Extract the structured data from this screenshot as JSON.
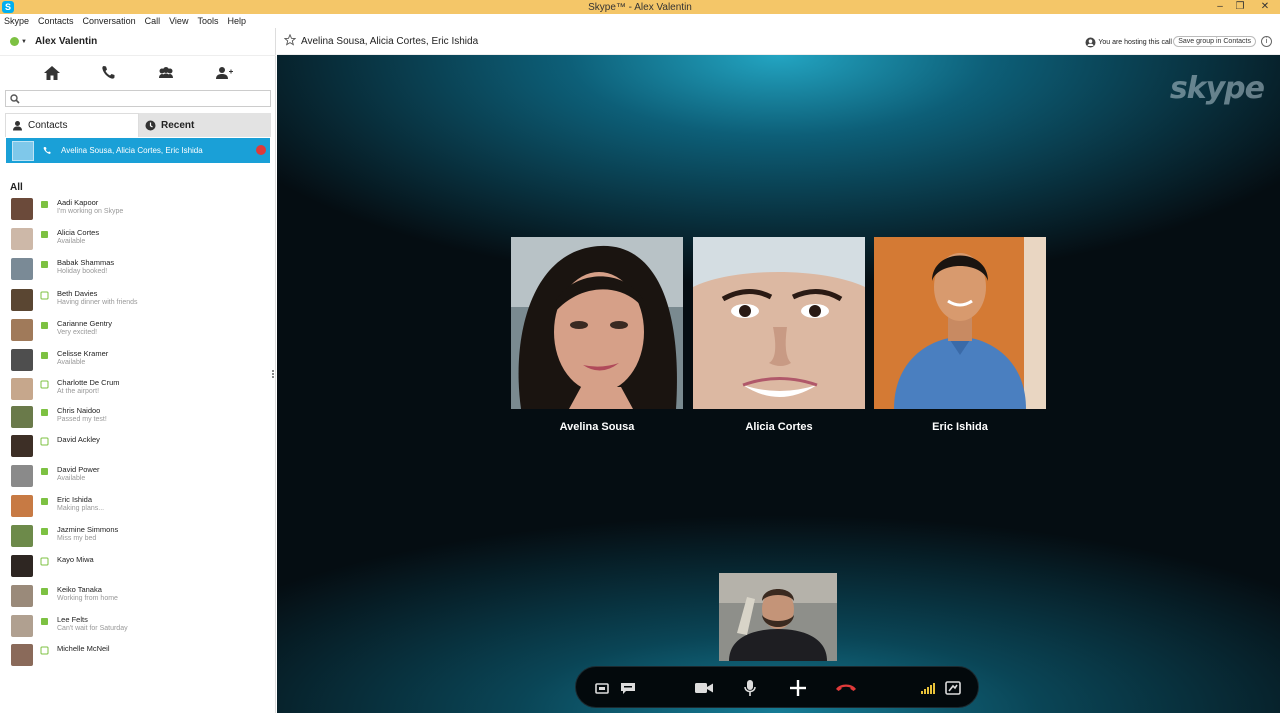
{
  "window": {
    "title": "Skype™ - Alex Valentin",
    "app_icon_letter": "S",
    "controls": [
      "–",
      "❐",
      "✕"
    ]
  },
  "menu": [
    "Skype",
    "Contacts",
    "Conversation",
    "Call",
    "View",
    "Tools",
    "Help"
  ],
  "user": {
    "name": "Alex Valentin",
    "status_color": "#7dc142"
  },
  "search": {
    "placeholder": ""
  },
  "tabs": {
    "contacts": "Contacts",
    "recent": "Recent"
  },
  "active_call": {
    "label": "Avelina Sousa, Alicia Cortes, Eric Ishida"
  },
  "section_label": "All",
  "contacts": [
    {
      "name": "Aadi Kapoor",
      "mood": "I'm working on Skype",
      "online": true,
      "avatar": "#6b4a3a"
    },
    {
      "name": "Alicia Cortes",
      "mood": "Available",
      "online": true,
      "avatar": "#cdb8a8"
    },
    {
      "name": "Babak Shammas",
      "mood": "Holiday booked!",
      "online": true,
      "avatar": "#7a8a96"
    },
    {
      "name": "Beth Davies",
      "mood": "Having dinner with friends",
      "online": false,
      "avatar": "#5a4632"
    },
    {
      "name": "Carianne Gentry",
      "mood": "Very excited!",
      "online": true,
      "avatar": "#a07a5a"
    },
    {
      "name": "Celisse Kramer",
      "mood": "Available",
      "online": true,
      "avatar": "#4e4e4e"
    },
    {
      "name": "Charlotte De Crum",
      "mood": "At the airport!",
      "online": false,
      "avatar": "#c6a78c"
    },
    {
      "name": "Chris Naidoo",
      "mood": "Passed my test!",
      "online": true,
      "avatar": "#6a7a4a"
    },
    {
      "name": "David Ackley",
      "mood": "",
      "online": false,
      "avatar": "#3d2f26"
    },
    {
      "name": "David Power",
      "mood": "Available",
      "online": true,
      "avatar": "#8a8a8a"
    },
    {
      "name": "Eric Ishida",
      "mood": "Making plans...",
      "online": true,
      "avatar": "#c77a44"
    },
    {
      "name": "Jazmine Simmons",
      "mood": "Miss my bed",
      "online": true,
      "avatar": "#6d8a4a"
    },
    {
      "name": "Kayo Miwa",
      "mood": "",
      "online": false,
      "avatar": "#2e2622"
    },
    {
      "name": "Keiko Tanaka",
      "mood": "Working from home",
      "online": true,
      "avatar": "#9a8a7a"
    },
    {
      "name": "Lee Felts",
      "mood": "Can't wait for Saturday",
      "online": true,
      "avatar": "#b0a090"
    },
    {
      "name": "Michelle McNeil",
      "mood": "",
      "online": false,
      "avatar": "#8a6a5a"
    }
  ],
  "call": {
    "title": "Avelina Sousa, Alicia Cortes, Eric Ishida",
    "hosting_text": "You are hosting this call",
    "save_group": "Save group in Contacts",
    "info_glyph": "i",
    "logo_text": "skype",
    "participants": [
      {
        "name": "Avelina Sousa"
      },
      {
        "name": "Alicia Cortes"
      },
      {
        "name": "Eric Ishida"
      }
    ]
  },
  "colors": {
    "accent": "#1aa0d7",
    "online": "#7dc142",
    "hangup": "#e03a3a",
    "titlebar": "#f4c668"
  }
}
